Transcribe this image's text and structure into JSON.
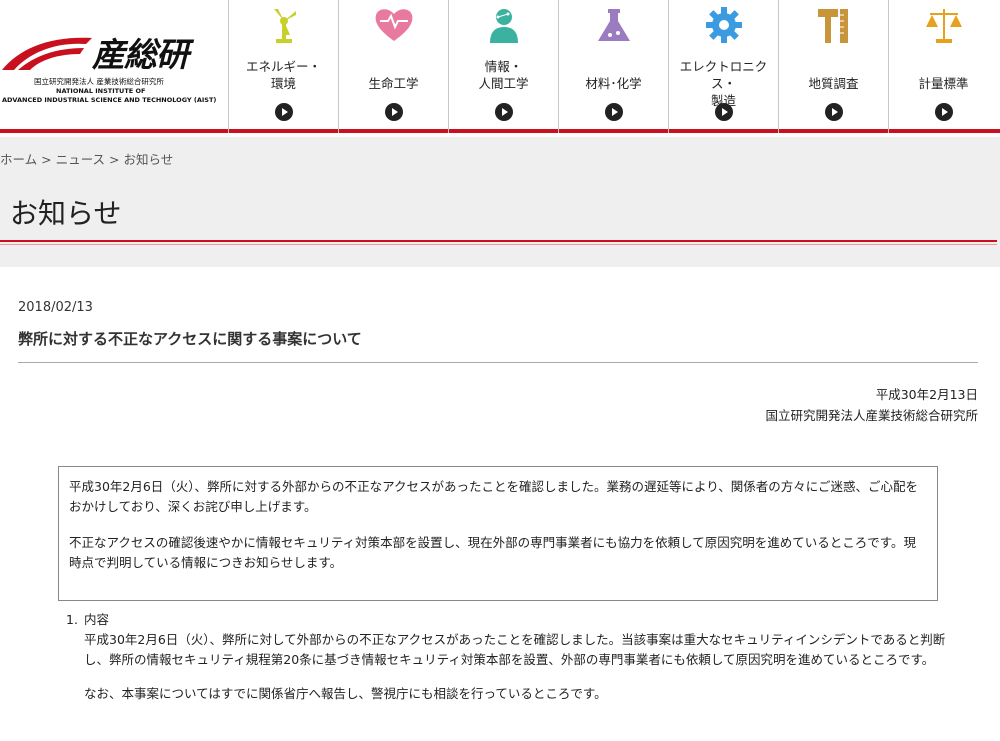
{
  "logo": {
    "kanji": "産総研",
    "jp_name": "国立研究開発法人 産業技術総合研究所",
    "en_line1": "NATIONAL INSTITUTE OF",
    "en_line2": "ADVANCED INDUSTRIAL SCIENCE AND TECHNOLOGY (AIST)",
    "color": "#c8101e"
  },
  "nav": {
    "items": [
      {
        "line1": "エネルギー・",
        "line2": "環境",
        "icon": "windmill-icon",
        "color": "#c9cf2b"
      },
      {
        "line1": "生命工学",
        "line2": "",
        "icon": "heart-icon",
        "color": "#e87aa0"
      },
      {
        "line1": "情報・",
        "line2": "人間工学",
        "icon": "person-network-icon",
        "color": "#3bb2a0"
      },
      {
        "line1": "材料･化学",
        "line2": "",
        "icon": "flask-icon",
        "color": "#9b7cc0"
      },
      {
        "line1": "エレクトロニクス・",
        "line2": "製造",
        "icon": "gear-icon",
        "color": "#3a9be0"
      },
      {
        "line1": "地質調査",
        "line2": "",
        "icon": "hammer-ruler-icon",
        "color": "#c8953a"
      },
      {
        "line1": "計量標準",
        "line2": "",
        "icon": "scale-icon",
        "color": "#e8a11c"
      }
    ]
  },
  "breadcrumb": {
    "home": "ホーム",
    "news": "ニュース",
    "current": "お知らせ",
    "sep": ">"
  },
  "page": {
    "title": "お知らせ"
  },
  "article": {
    "date": "2018/02/13",
    "title": "弊所に対する不正なアクセスに関する事案について",
    "meta_date": "平成30年2月13日",
    "meta_org": "国立研究開発法人産業技術総合研究所",
    "notice_p1": "平成30年2月6日（火）、弊所に対する外部からの不正なアクセスがあったことを確認しました。業務の遅延等により、関係者の方々にご迷惑、ご心配をおかけしており、深くお詫び申し上げます。",
    "notice_p2": "不正なアクセスの確認後速やかに情報セキュリティ対策本部を設置し、現在外部の専門事業者にも協力を依頼して原因究明を進めているところです。現時点で判明している情報につきお知らせします。",
    "section1_num": "1.",
    "section1_head": "内容",
    "section1_p1": "平成30年2月6日（火）、弊所に対して外部からの不正なアクセスがあったことを確認しました。当該事案は重大なセキュリティインシデントであると判断し、弊所の情報セキュリティ規程第20条に基づき情報セキュリティ対策本部を設置、外部の専門事業者にも依頼して原因究明を進めているところです。",
    "section1_p2": "なお、本事案についてはすでに関係省庁へ報告し、警視庁にも相談を行っているところです。"
  }
}
